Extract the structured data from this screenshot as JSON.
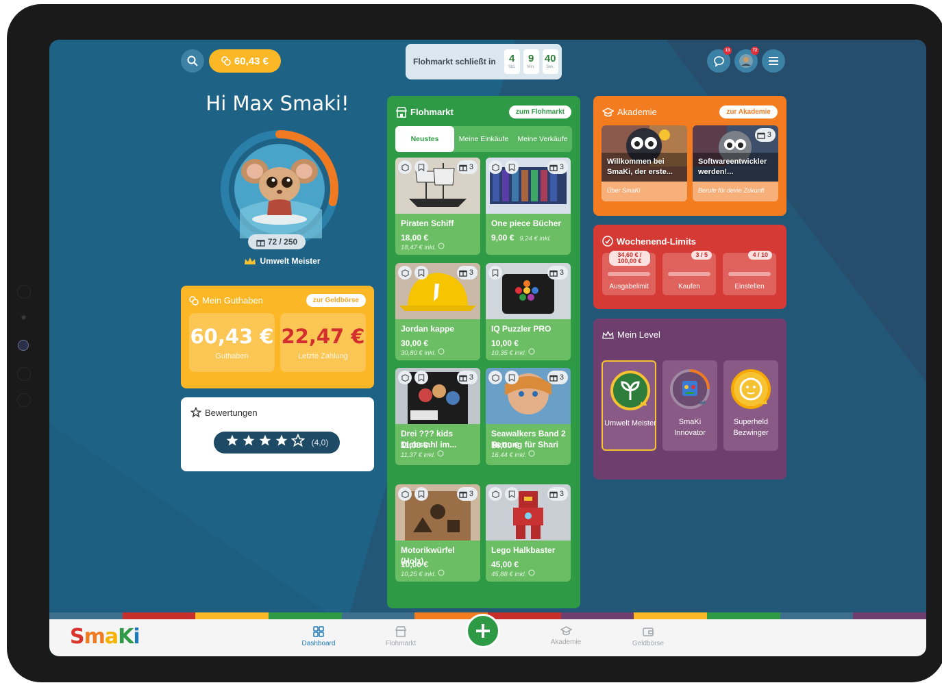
{
  "header": {
    "balance": "60,43 €",
    "timer_label": "Flohmarkt schließt in",
    "timer": [
      {
        "value": "4",
        "unit": "Std."
      },
      {
        "value": "9",
        "unit": "Min."
      },
      {
        "value": "40",
        "unit": "Sek."
      }
    ],
    "chat_badge": "13",
    "profile_badge": "72"
  },
  "profile": {
    "greeting": "Hi Max Smaki!",
    "xp": "72 / 250",
    "xp_progress": 0.288,
    "title": "Umwelt Meister"
  },
  "guthaben": {
    "title": "Mein Guthaben",
    "button": "zur Geldbörse",
    "balance_value": "60,43 €",
    "balance_label": "Guthaben",
    "last_value": "22,47 €",
    "last_label": "Letzte Zahlung",
    "colors": {
      "balance": "#ffffff",
      "last": "#d32f2f"
    }
  },
  "bewertungen": {
    "title": "Bewertungen",
    "stars_filled": 4,
    "stars_total": 5,
    "rating": "(4,0)"
  },
  "flohmarkt": {
    "title": "Flohmarkt",
    "button": "zum Flohmarkt",
    "tabs": [
      "Neustes",
      "Meine Einkäufe",
      "Meine Verkäufe"
    ],
    "items": [
      {
        "name": "Piraten Schiff",
        "price": "18,00 €",
        "incl": "18,47 € inkl.",
        "count": "3"
      },
      {
        "name": "One piece Bücher",
        "price": "9,00 €",
        "incl": "9,24 € inkl.",
        "count": "3"
      },
      {
        "name": "Jordan kappe",
        "price": "30,00 €",
        "incl": "30,80 € inkl.",
        "count": "3"
      },
      {
        "name": "IQ Puzzler PRO",
        "price": "10,00 €",
        "incl": "10,35 € inkl.",
        "count": "3"
      },
      {
        "name": "Drei ??? kids Diebstahl im...",
        "price": "11,00 €",
        "incl": "11,37 € inkl.",
        "count": "3"
      },
      {
        "name": "Seawalkers Band 2 Rettung für Shari",
        "price": "16,00 €",
        "incl": "16,44 € inkl.",
        "count": "3"
      },
      {
        "name": "Motorikwürfel (Holz)",
        "price": "10,00 €",
        "incl": "10,25 € inkl.",
        "count": "3"
      },
      {
        "name": "Lego Halkbaster",
        "price": "45,00 €",
        "incl": "45,88 € inkl.",
        "count": "3"
      }
    ]
  },
  "akademie": {
    "title": "Akademie",
    "button": "zur Akademie",
    "courses": [
      {
        "title": "Willkommen bei SmaKi, der erste...",
        "sub": "Über SmaKi",
        "count": ""
      },
      {
        "title": "Softwareentwickler werden!...",
        "sub": "Berufe für deine Zukunft",
        "count": "3"
      }
    ]
  },
  "limits": {
    "title": "Wochenend-Limits",
    "items": [
      {
        "label": "Ausgabelimit",
        "pill": "34,60 € / 100,00 €"
      },
      {
        "label": "Kaufen",
        "pill": "3 / 5"
      },
      {
        "label": "Einstellen",
        "pill": "4 / 10"
      }
    ]
  },
  "level": {
    "title": "Mein Level",
    "items": [
      {
        "label": "Umwelt Meister",
        "icon": "sprout-icon",
        "color": "#2e9a45"
      },
      {
        "label": "SmaKi Innovator",
        "icon": "robot-icon",
        "color": "#5b6b8a"
      },
      {
        "label": "Superheld Bezwinger",
        "icon": "lion-icon",
        "color": "#f6c232"
      }
    ]
  },
  "nav": {
    "logo": "SmaKi",
    "items": [
      {
        "label": "Dashboard",
        "icon": "dashboard-icon"
      },
      {
        "label": "Flohmarkt",
        "icon": "store-icon"
      },
      {
        "label": "Akademie",
        "icon": "graduation-cap-icon"
      },
      {
        "label": "Geldbörse",
        "icon": "wallet-icon"
      }
    ]
  }
}
